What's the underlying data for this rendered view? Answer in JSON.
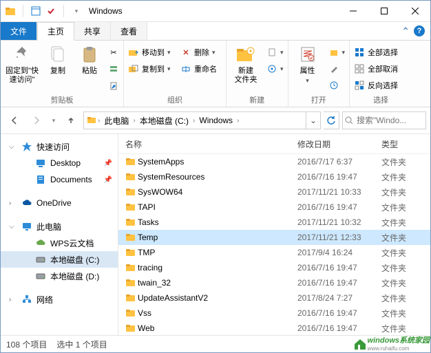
{
  "window": {
    "title": "Windows"
  },
  "tabs": {
    "file": "文件",
    "home": "主页",
    "share": "共享",
    "view": "查看"
  },
  "ribbon": {
    "clipboard": {
      "pin": "固定到\"快速访问\"",
      "copy": "复制",
      "paste": "粘贴",
      "label": "剪贴板"
    },
    "organize": {
      "moveto": "移动到",
      "copyto": "复制到",
      "delete": "删除",
      "rename": "重命名",
      "label": "组织"
    },
    "new_group": {
      "newfolder": "新建\n文件夹",
      "label": "新建"
    },
    "open": {
      "props": "属性",
      "label": "打开"
    },
    "select": {
      "all": "全部选择",
      "none": "全部取消",
      "invert": "反向选择",
      "label": "选择"
    }
  },
  "breadcrumbs": [
    "此电脑",
    "本地磁盘 (C:)",
    "Windows"
  ],
  "search": {
    "placeholder": "搜索\"Windo..."
  },
  "navpane": [
    {
      "type": "top",
      "icon": "star",
      "color": "#2d8cd8",
      "label": "快速访问",
      "exp": true
    },
    {
      "type": "sub",
      "icon": "desktop",
      "color": "#2d8cd8",
      "label": "Desktop",
      "pin": true
    },
    {
      "type": "sub",
      "icon": "doc",
      "color": "#2d8cd8",
      "label": "Documents",
      "pin": true
    },
    {
      "type": "gap"
    },
    {
      "type": "top",
      "icon": "cloud",
      "color": "#0a57a4",
      "label": "OneDrive",
      "exp": false
    },
    {
      "type": "gap"
    },
    {
      "type": "top",
      "icon": "pc",
      "color": "#2d8cd8",
      "label": "此电脑",
      "exp": true
    },
    {
      "type": "sub",
      "icon": "cloud2",
      "color": "#6aa84f",
      "label": "WPS云文档"
    },
    {
      "type": "sub",
      "icon": "drive",
      "color": "#9aa0a6",
      "label": "本地磁盘 (C:)",
      "sel": true
    },
    {
      "type": "sub",
      "icon": "drive",
      "color": "#9aa0a6",
      "label": "本地磁盘 (D:)"
    },
    {
      "type": "gap"
    },
    {
      "type": "top",
      "icon": "net",
      "color": "#2d8cd8",
      "label": "网络",
      "exp": false
    }
  ],
  "columns": {
    "name": "名称",
    "date": "修改日期",
    "type": "类型"
  },
  "files": [
    {
      "name": "SystemApps",
      "date": "2016/7/17 6:37",
      "type": "文件夹"
    },
    {
      "name": "SystemResources",
      "date": "2016/7/16 19:47",
      "type": "文件夹"
    },
    {
      "name": "SysWOW64",
      "date": "2017/11/21 10:33",
      "type": "文件夹"
    },
    {
      "name": "TAPI",
      "date": "2016/7/16 19:47",
      "type": "文件夹"
    },
    {
      "name": "Tasks",
      "date": "2017/11/21 10:32",
      "type": "文件夹"
    },
    {
      "name": "Temp",
      "date": "2017/11/21 12:33",
      "type": "文件夹",
      "sel": true
    },
    {
      "name": "TMP",
      "date": "2017/9/4 16:24",
      "type": "文件夹"
    },
    {
      "name": "tracing",
      "date": "2016/7/16 19:47",
      "type": "文件夹"
    },
    {
      "name": "twain_32",
      "date": "2016/7/16 19:47",
      "type": "文件夹"
    },
    {
      "name": "UpdateAssistantV2",
      "date": "2017/8/24 7:27",
      "type": "文件夹"
    },
    {
      "name": "Vss",
      "date": "2016/7/16 19:47",
      "type": "文件夹"
    },
    {
      "name": "Web",
      "date": "2016/7/16 19:47",
      "type": "文件夹"
    }
  ],
  "status": {
    "count": "108 个项目",
    "sel": "选中 1 个项目"
  },
  "watermark": {
    "title": "windows系统家园",
    "sub": "www.ruhaifu.com"
  }
}
